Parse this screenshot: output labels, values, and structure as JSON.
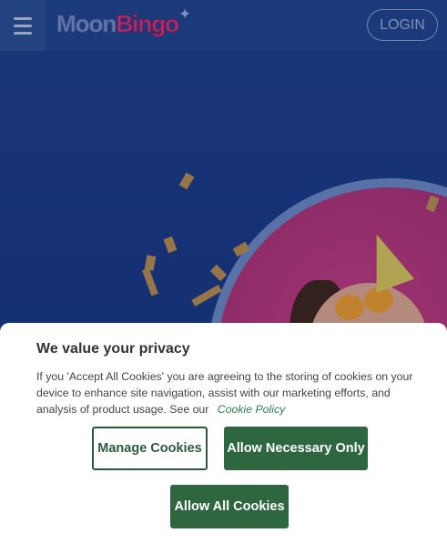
{
  "header": {
    "logo_moon": "Moon",
    "logo_bingo": "Bingo",
    "login_label": "LOGIN"
  },
  "cookie_banner": {
    "title": "We value your privacy",
    "body": "If you 'Accept All Cookies' you are agreeing to the storing of cookies on your device to enhance site navigation, assist with our marketing efforts, and analysis of product usage. See our",
    "policy_link": "Cookie Policy",
    "manage_label": "Manage Cookies",
    "necessary_label": "Allow Necessary Only",
    "allow_all_label": "Allow All Cookies"
  },
  "colors": {
    "header_bg": "#1f4389",
    "hero_bg": "#1a3a7e",
    "accent_green": "#2e6640",
    "logo_pink": "#d1357f"
  },
  "icons": {
    "menu": "hamburger-menu-icon",
    "logo_star": "sparkle-icon"
  }
}
